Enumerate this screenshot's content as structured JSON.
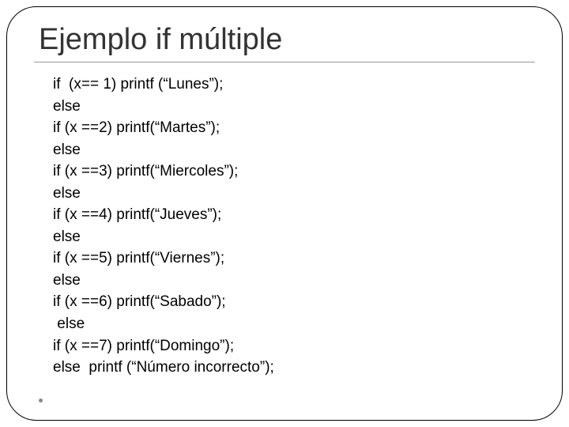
{
  "slide": {
    "title": "Ejemplo if múltiple",
    "code_lines": [
      "if  (x== 1) printf (“Lunes”);",
      "else",
      "if (x ==2) printf(“Martes”);",
      "else",
      "if (x ==3) printf(“Miercoles”);",
      "else",
      "if (x ==4) printf(“Jueves”);",
      "else",
      "if (x ==5) printf(“Viernes”);",
      "else",
      "if (x ==6) printf(“Sabado”);",
      " else",
      "if (x ==7) printf(“Domingo”);",
      "else  printf (“Número incorrecto”);"
    ]
  }
}
